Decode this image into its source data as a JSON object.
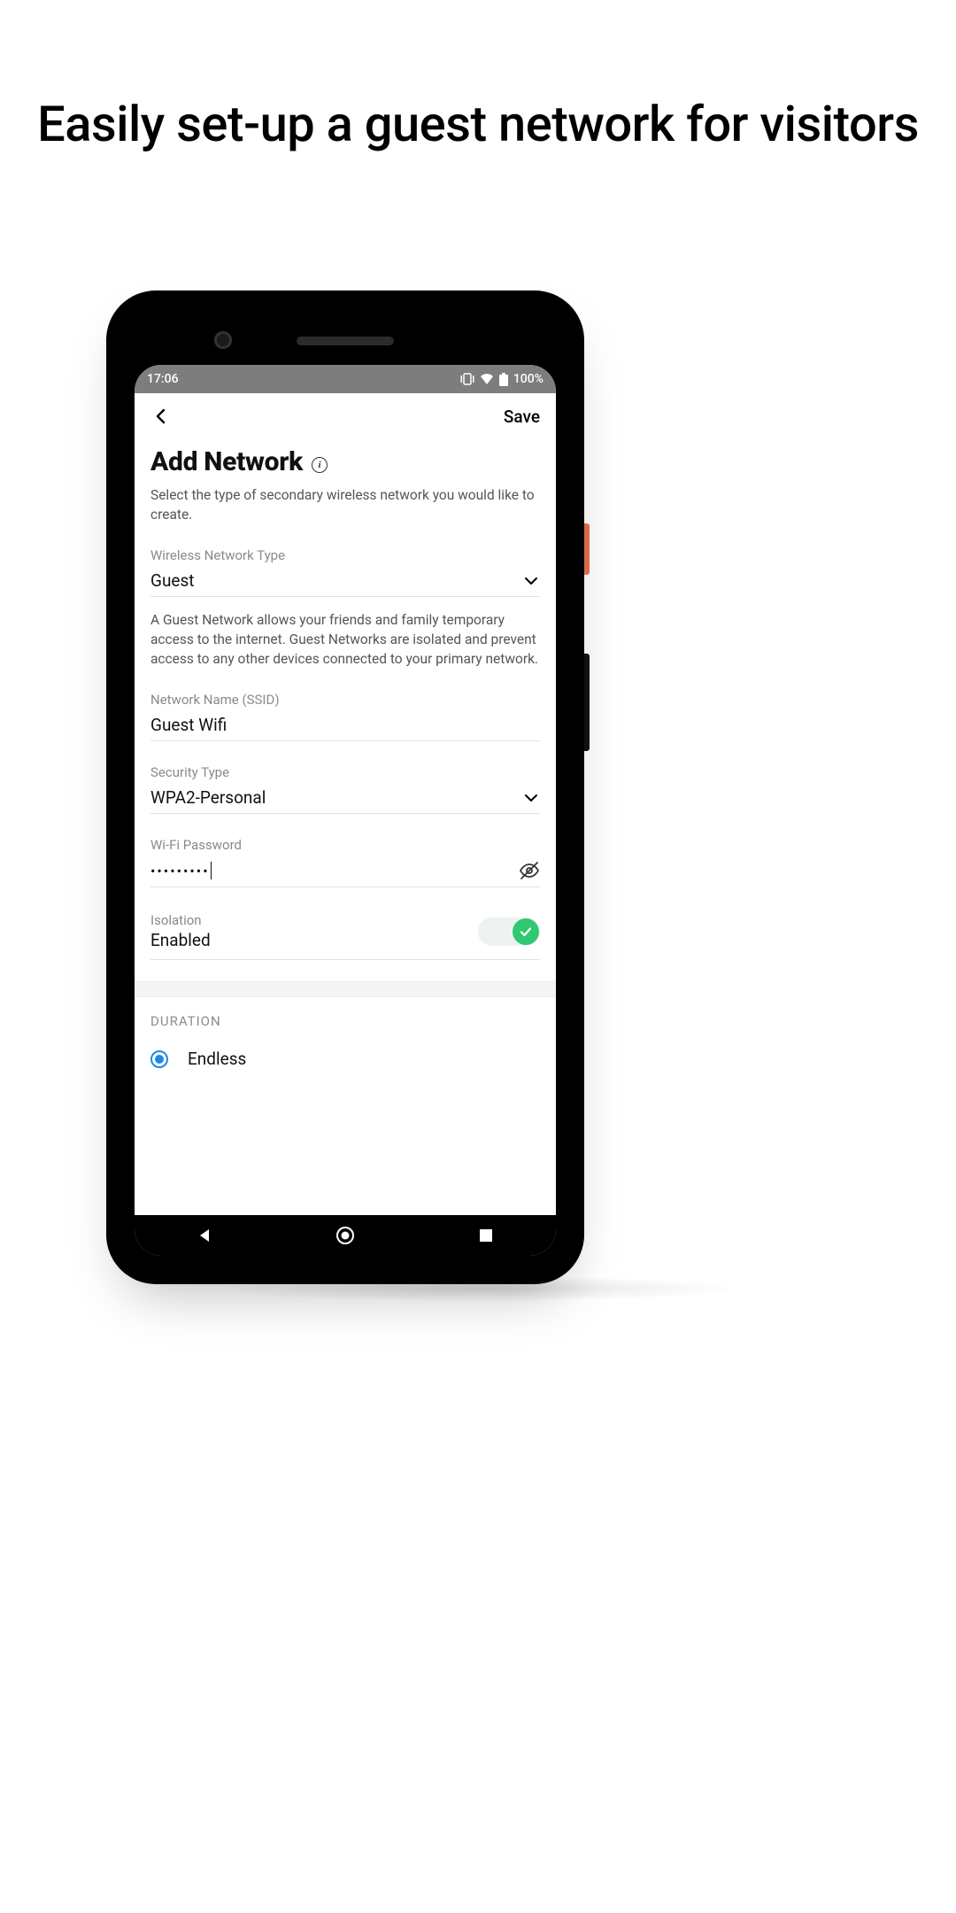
{
  "marketing_headline": "Easily set-up a guest network for visitors",
  "statusbar": {
    "time": "17:06",
    "battery": "100%"
  },
  "header": {
    "save_label": "Save"
  },
  "page": {
    "title": "Add Network",
    "subtitle": "Select the type of secondary wireless network you would like to create."
  },
  "fields": {
    "network_type": {
      "label": "Wireless Network Type",
      "value": "Guest"
    },
    "network_type_desc": "A Guest Network allows your friends and family temporary access to the internet. Guest Networks are isolated and prevent access to any other devices connected to your primary network.",
    "ssid": {
      "label": "Network Name (SSID)",
      "value": "Guest Wifi"
    },
    "security": {
      "label": "Security Type",
      "value": "WPA2-Personal"
    },
    "password": {
      "label": "Wi-Fi Password",
      "masked": "•••••••••"
    },
    "isolation": {
      "label": "Isolation",
      "value": "Enabled"
    }
  },
  "duration": {
    "section": "DURATION",
    "option_endless": "Endless"
  }
}
